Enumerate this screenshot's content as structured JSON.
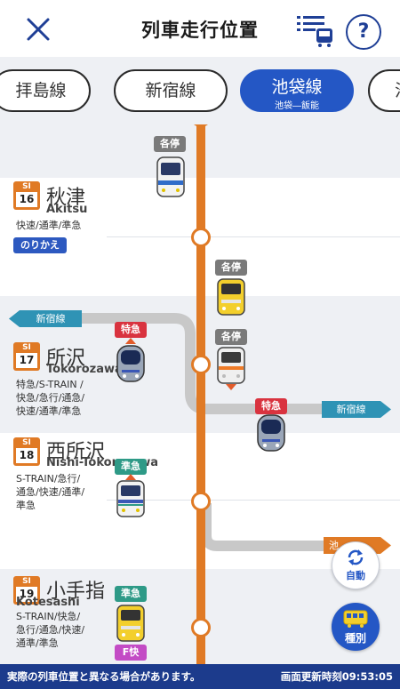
{
  "header": {
    "title": "列車走行位置",
    "close_icon": "close-icon",
    "list_icon": "train-list-icon",
    "help_label": "?"
  },
  "tabs": [
    {
      "label": "拝島線"
    },
    {
      "label": "新宿線"
    },
    {
      "label": "池袋線",
      "sublabel": "池袋―飯能",
      "active": true
    },
    {
      "label": "池"
    }
  ],
  "stations": [
    {
      "code": "SI",
      "number": "16",
      "name": "秋津",
      "roman": "Akitsu",
      "types": [
        "快速/通準/準急"
      ],
      "transfer": "のりかえ"
    },
    {
      "code": "SI",
      "number": "17",
      "name": "所沢",
      "roman": "Tokorozawa",
      "types": [
        "特急/S-TRAIN /",
        "快急/急行/通急/",
        "快速/通準/準急"
      ]
    },
    {
      "code": "SI",
      "number": "18",
      "name": "西所沢",
      "roman": "Nishi-Tokorozawa",
      "types": [
        "S-TRAIN/急行/",
        "通急/快速/通準/",
        "準急"
      ]
    },
    {
      "code": "SI",
      "number": "19",
      "name": "小手指",
      "roman": "Kotesashi",
      "types": [
        "S-TRAIN/快急/",
        "急行/通急/快速/",
        "通準/準急"
      ]
    }
  ],
  "trains": [
    {
      "type": "各停"
    },
    {
      "type": "各停"
    },
    {
      "type": "特急"
    },
    {
      "type": "各停"
    },
    {
      "type": "特急"
    },
    {
      "type": "準急"
    },
    {
      "type": "準急"
    },
    {
      "type": "F快"
    }
  ],
  "branches": [
    {
      "label": "新宿線"
    },
    {
      "label": "新宿線"
    },
    {
      "label": "池"
    }
  ],
  "buttons": {
    "auto_label": "自動",
    "kind_label": "種別"
  },
  "footer": {
    "note": "実際の列車位置と異なる場合があります。",
    "updated": "画面更新時刻09:53:05"
  },
  "colors": {
    "accent": "#2457c5",
    "line": "#e07a25",
    "footer": "#1c3b8c"
  }
}
